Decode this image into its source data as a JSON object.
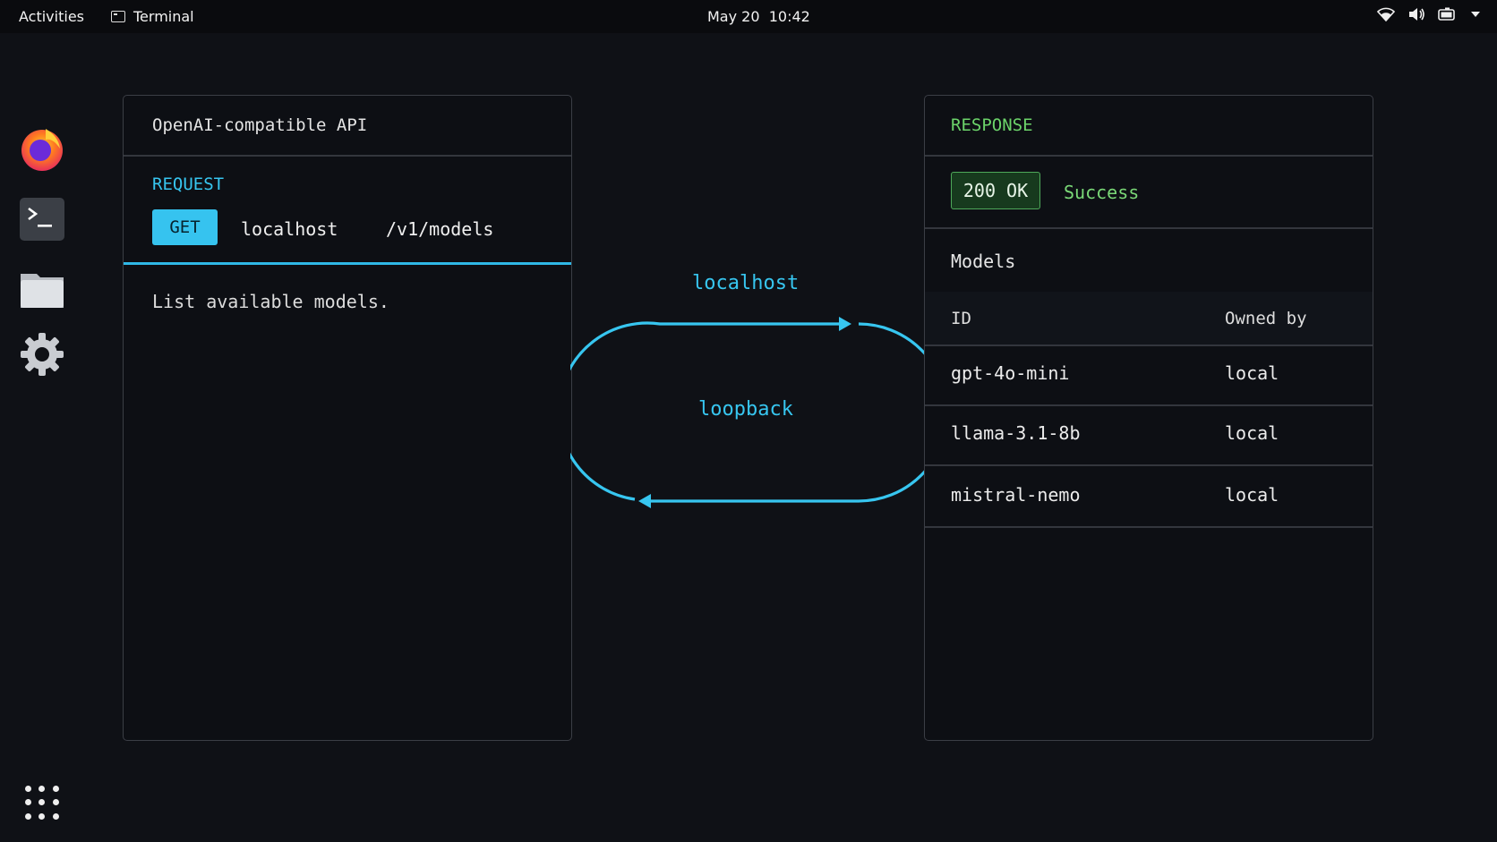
{
  "topbar": {
    "activities": "Activities",
    "app_name": "Terminal",
    "date": "May 20",
    "time": "10:42"
  },
  "dock": {
    "items": [
      "firefox-icon",
      "terminal-icon",
      "files-icon",
      "settings-icon"
    ],
    "apps_grid": "app-grid-icon"
  },
  "request_panel": {
    "title": "OpenAI-compatible API",
    "section_label": "REQUEST",
    "method": "GET",
    "host": "localhost",
    "path": "/v1/models",
    "description": "List available models."
  },
  "flow": {
    "top_label": "localhost",
    "center_label": "loopback",
    "color": "#37c6f0"
  },
  "response_panel": {
    "section_label": "RESPONSE",
    "status_code": "200 OK",
    "status_text": "Success",
    "models_title": "Models",
    "columns": [
      "ID",
      "Owned by"
    ],
    "rows": [
      {
        "id": "gpt-4o-mini",
        "owner": "local"
      },
      {
        "id": "llama-3.1-8b",
        "owner": "local"
      },
      {
        "id": "mistral-nemo",
        "owner": "local"
      }
    ]
  },
  "colors": {
    "accent_blue": "#36c3ef",
    "accent_green": "#6cd46a",
    "background": "#0f1116"
  }
}
